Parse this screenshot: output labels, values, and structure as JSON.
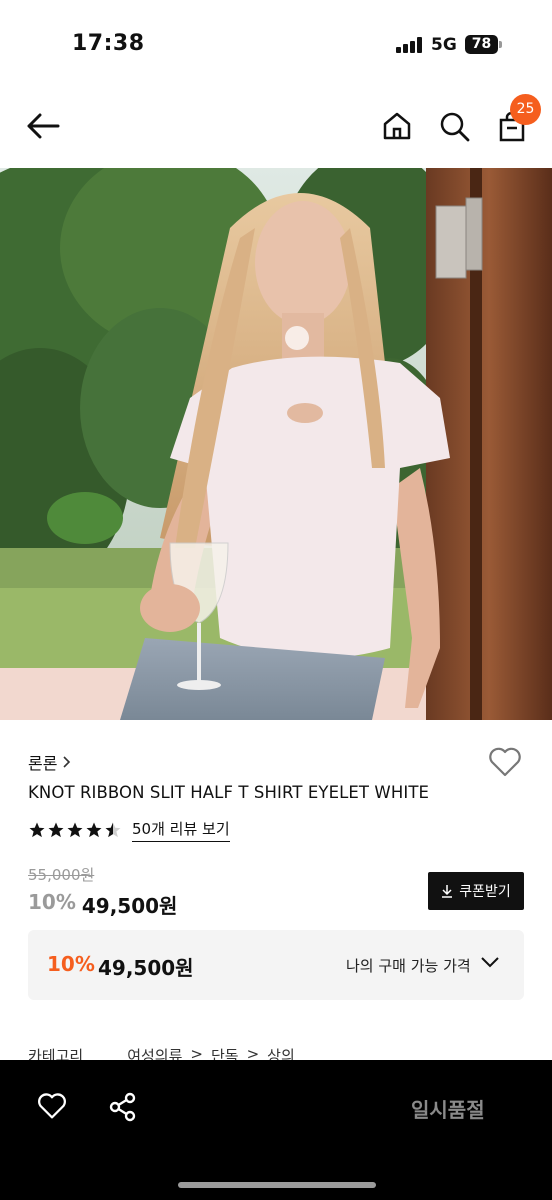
{
  "status_bar": {
    "time": "17:38",
    "network": "5G",
    "battery": "78"
  },
  "header": {
    "cart_count": "25"
  },
  "product": {
    "brand": "론론",
    "name": "KNOT RIBBON SLIT HALF T SHIRT EYELET WHITE",
    "rating": 4.5,
    "review_link": "50개 리뷰 보기",
    "original_price": "55,000원",
    "discount_pct": "10%",
    "sale_price": "49,500원",
    "coupon_label": "쿠폰받기"
  },
  "my_price": {
    "discount_pct": "10%",
    "price": "49,500원",
    "label": "나의 구매 가능 가격"
  },
  "category": {
    "label": "카테고리",
    "path": [
      "여성의류",
      "단독",
      "상의"
    ]
  },
  "bottom_bar": {
    "soldout_label": "일시품절"
  },
  "colors": {
    "accent": "#f55e1e",
    "dark": "#000000",
    "muted": "#9a9a9a",
    "panel": "#f4f4f4"
  },
  "icons": [
    "back-arrow-icon",
    "home-icon",
    "search-icon",
    "shopping-bag-icon",
    "chevron-right-icon",
    "heart-icon",
    "star-icon",
    "download-icon",
    "chevron-down-icon",
    "share-icon"
  ]
}
